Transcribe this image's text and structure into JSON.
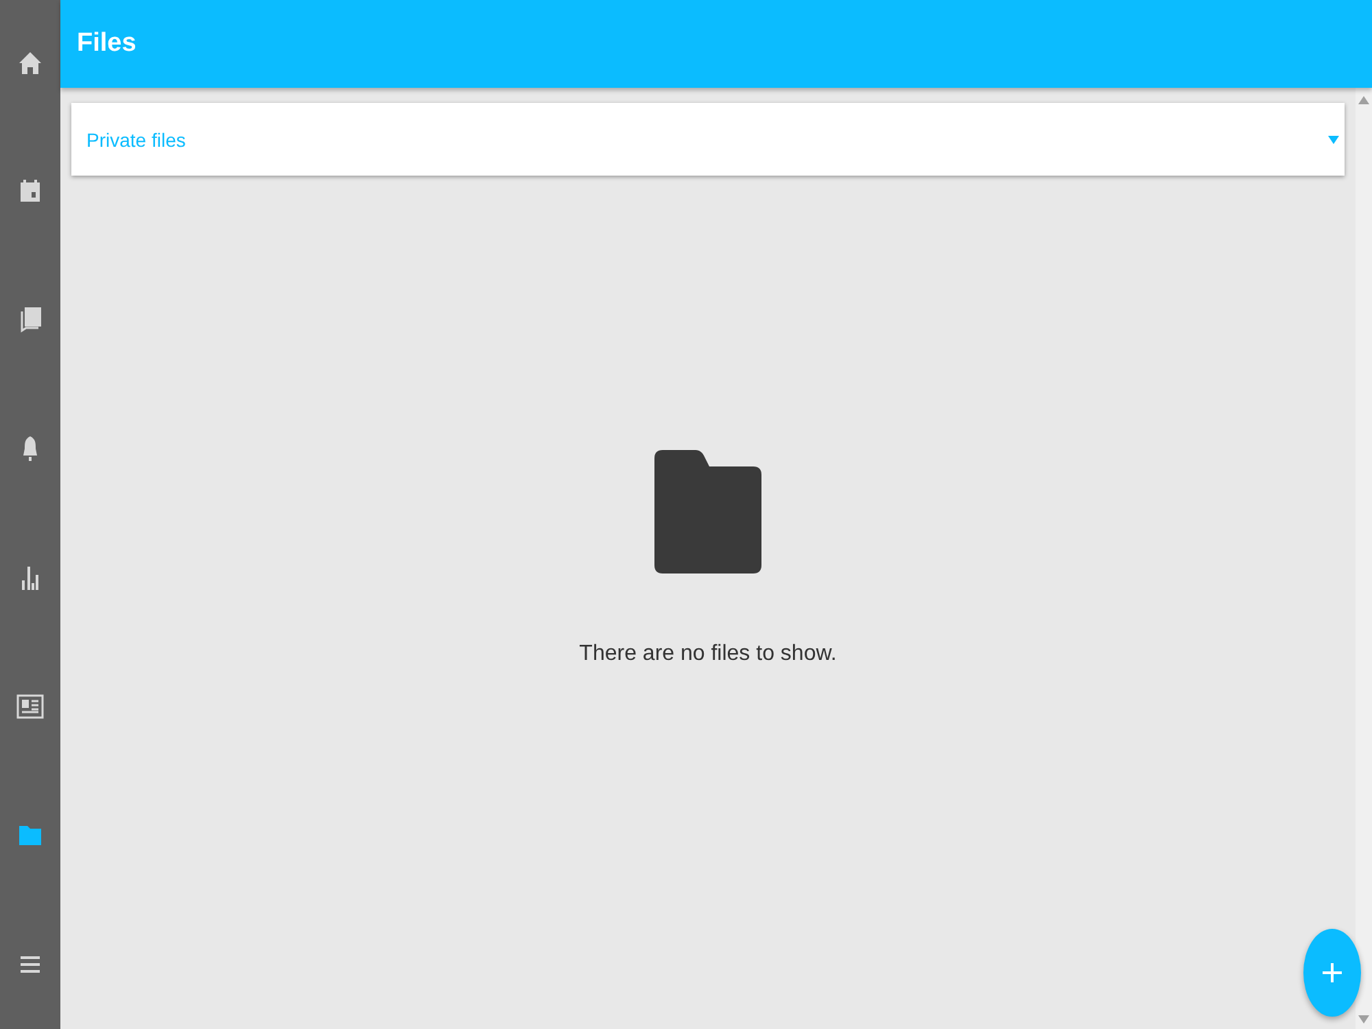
{
  "sidebar": {
    "items": [
      {
        "kind": "home",
        "selected": false
      },
      {
        "kind": "calendar",
        "selected": false
      },
      {
        "kind": "book",
        "selected": false
      },
      {
        "kind": "bell",
        "selected": false
      },
      {
        "kind": "chart",
        "selected": false
      },
      {
        "kind": "news",
        "selected": false
      },
      {
        "kind": "folder",
        "selected": true
      },
      {
        "kind": "menu",
        "selected": false
      }
    ]
  },
  "header": {
    "title": "Files"
  },
  "dropdown": {
    "value": "Private files"
  },
  "empty_state": {
    "message": "There are no files to show."
  }
}
